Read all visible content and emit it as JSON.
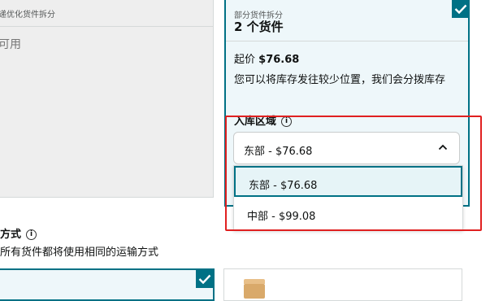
{
  "left_option": {
    "subtitle": "递优化货件拆分",
    "status": "可用"
  },
  "selected_option": {
    "label": "部分货件拆分",
    "title": "2 个货件",
    "price_prefix": "起价",
    "price": "$76.68",
    "description": "您可以将库存发往较少位置，我们会分拨库存",
    "region_label": "入库区域",
    "info_icon_glyph": "i"
  },
  "region_select": {
    "value": "东部 - $76.68",
    "options": [
      {
        "label": "东部 - $76.68",
        "selected": true
      },
      {
        "label": "中部 - $99.08",
        "selected": false
      }
    ]
  },
  "shipping_method": {
    "title": "方式",
    "info_icon_glyph": "i",
    "description": "所有货件都将使用相同的运输方式"
  },
  "colors": {
    "accent": "#007185",
    "selected_bg": "#eef7fa",
    "highlight": "#e02020"
  }
}
